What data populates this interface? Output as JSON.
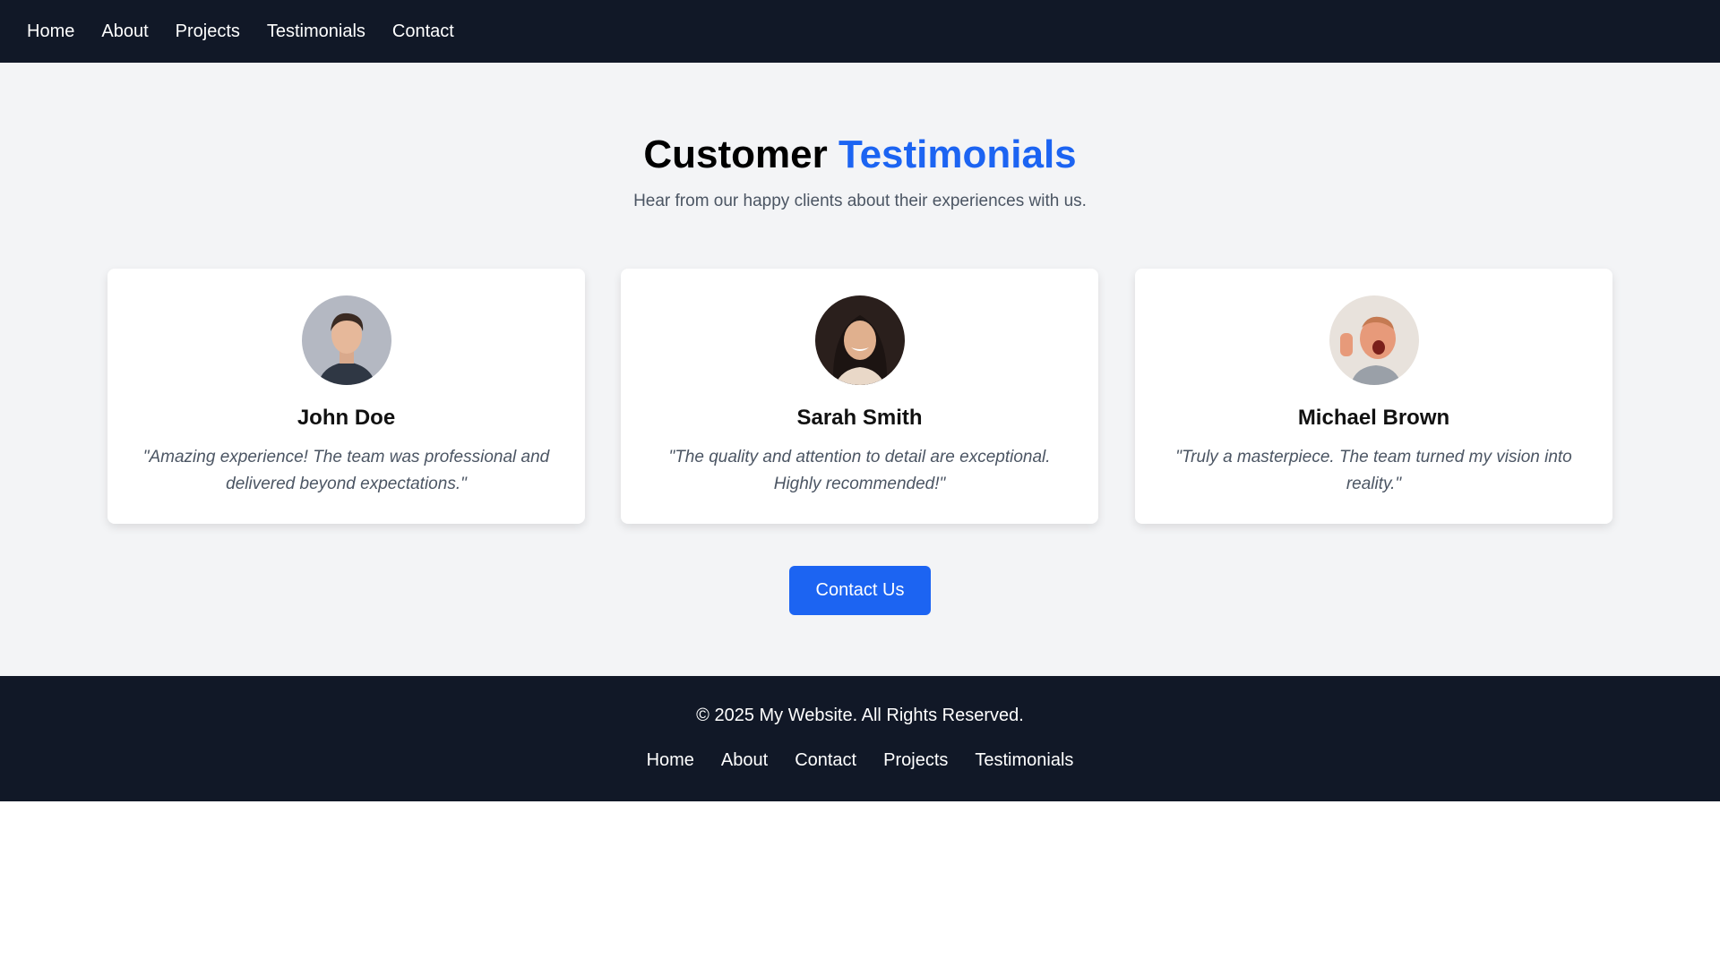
{
  "nav": {
    "items": [
      "Home",
      "About",
      "Projects",
      "Testimonials",
      "Contact"
    ]
  },
  "section": {
    "title_main": "Customer",
    "title_accent": "Testimonials",
    "subtitle": "Hear from our happy clients about their experiences with us."
  },
  "testimonials": [
    {
      "name": "John Doe",
      "quote": "\"Amazing experience! The team was professional and delivered beyond expectations.\""
    },
    {
      "name": "Sarah Smith",
      "quote": "\"The quality and attention to detail are exceptional. Highly recommended!\""
    },
    {
      "name": "Michael Brown",
      "quote": "\"Truly a masterpiece. The team turned my vision into reality.\""
    }
  ],
  "cta": {
    "label": "Contact Us"
  },
  "footer": {
    "copyright": "© 2025 My Website. All Rights Reserved.",
    "links": [
      "Home",
      "About",
      "Contact",
      "Projects",
      "Testimonials"
    ]
  },
  "colors": {
    "accent": "#1c64f2",
    "nav_bg": "#111827",
    "page_bg": "#f3f4f6"
  }
}
